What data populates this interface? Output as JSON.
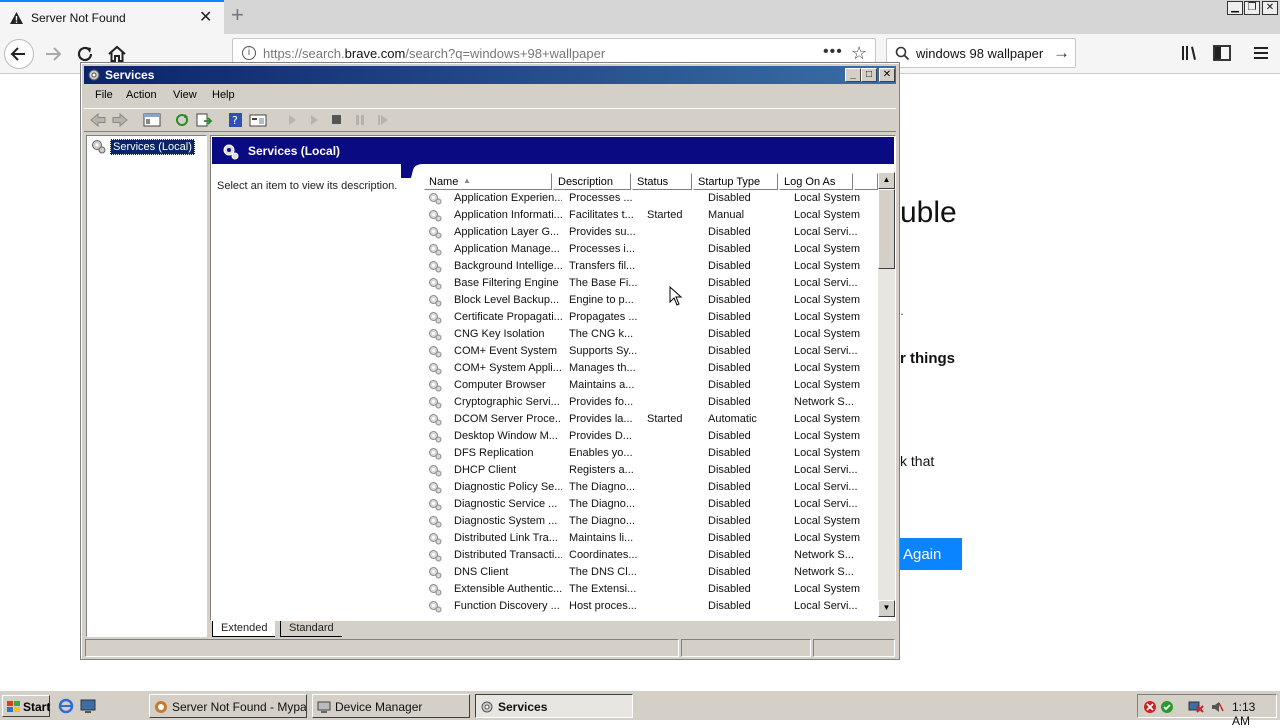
{
  "browser": {
    "tab_title": "Server Not Found",
    "url_prefix": "https://search.",
    "url_domain": "brave.com",
    "url_rest": "/search?q=windows+98+wallpaper",
    "url_more": "•••",
    "search_text": "windows 98 wallpaper",
    "icons": [
      "warning-icon",
      "close-icon",
      "new-tab-icon",
      "back-icon",
      "forward-icon",
      "reload-icon",
      "home-icon",
      "info-icon",
      "star-icon",
      "search-icon",
      "library-icon",
      "sidebar-icon",
      "menu-icon"
    ]
  },
  "webpage": {
    "heading_fragment": "uble",
    "text_fragment_1": ".",
    "bold_fragment": "r things",
    "text_fragment_2": "k that",
    "button_fragment": "Again"
  },
  "services_window": {
    "title": "Services",
    "menu": [
      "File",
      "Action",
      "View",
      "Help"
    ],
    "tree_node": "Services (Local)",
    "header_title": "Services (Local)",
    "description_prompt": "Select an item to view its description.",
    "columns": [
      "Name",
      "Description",
      "Status",
      "Startup Type",
      "Log On As"
    ],
    "rows": [
      [
        "Application Experien...",
        "Processes ...",
        "",
        "Disabled",
        "Local System"
      ],
      [
        "Application Informati...",
        "Facilitates t...",
        "Started",
        "Manual",
        "Local System"
      ],
      [
        "Application Layer G...",
        "Provides su...",
        "",
        "Disabled",
        "Local Servi..."
      ],
      [
        "Application Manage...",
        "Processes i...",
        "",
        "Disabled",
        "Local System"
      ],
      [
        "Background Intellige...",
        "Transfers fil...",
        "",
        "Disabled",
        "Local System"
      ],
      [
        "Base Filtering Engine",
        "The Base Fi...",
        "",
        "Disabled",
        "Local Servi..."
      ],
      [
        "Block Level Backup...",
        "Engine to p...",
        "",
        "Disabled",
        "Local System"
      ],
      [
        "Certificate Propagati...",
        "Propagates ...",
        "",
        "Disabled",
        "Local System"
      ],
      [
        "CNG Key Isolation",
        "The CNG k...",
        "",
        "Disabled",
        "Local System"
      ],
      [
        "COM+ Event System",
        "Supports Sy...",
        "",
        "Disabled",
        "Local Servi..."
      ],
      [
        "COM+ System Appli...",
        "Manages th...",
        "",
        "Disabled",
        "Local System"
      ],
      [
        "Computer Browser",
        "Maintains a...",
        "",
        "Disabled",
        "Local System"
      ],
      [
        "Cryptographic Servi...",
        "Provides fo...",
        "",
        "Disabled",
        "Network S..."
      ],
      [
        "DCOM Server Proce...",
        "Provides la...",
        "Started",
        "Automatic",
        "Local System"
      ],
      [
        "Desktop Window M...",
        "Provides D...",
        "",
        "Disabled",
        "Local System"
      ],
      [
        "DFS Replication",
        "Enables yo...",
        "",
        "Disabled",
        "Local System"
      ],
      [
        "DHCP Client",
        "Registers a...",
        "",
        "Disabled",
        "Local Servi..."
      ],
      [
        "Diagnostic Policy Se...",
        "The Diagno...",
        "",
        "Disabled",
        "Local Servi..."
      ],
      [
        "Diagnostic Service ...",
        "The Diagno...",
        "",
        "Disabled",
        "Local Servi..."
      ],
      [
        "Diagnostic System ...",
        "The Diagno...",
        "",
        "Disabled",
        "Local System"
      ],
      [
        "Distributed Link Tra...",
        "Maintains li...",
        "",
        "Disabled",
        "Local System"
      ],
      [
        "Distributed Transacti...",
        "Coordinates...",
        "",
        "Disabled",
        "Network S..."
      ],
      [
        "DNS Client",
        "The DNS Cl...",
        "",
        "Disabled",
        "Network S..."
      ],
      [
        "Extensible Authentic...",
        "The Extensi...",
        "",
        "Disabled",
        "Local System"
      ],
      [
        "Function Discovery ...",
        "Host proces...",
        "",
        "Disabled",
        "Local Servi..."
      ]
    ],
    "bottom_tabs": [
      "Extended",
      "Standard"
    ]
  },
  "taskbar": {
    "start_label": "Start",
    "buttons": [
      "Server Not Found - Mypal",
      "Device Manager",
      "Services"
    ],
    "clock": "1:13 AM"
  },
  "colors": {
    "accent_blue": "#0a84ff",
    "title_bar": "#0a246a",
    "header_band": "#0a0a82",
    "win_face": "#d4d0c8"
  }
}
